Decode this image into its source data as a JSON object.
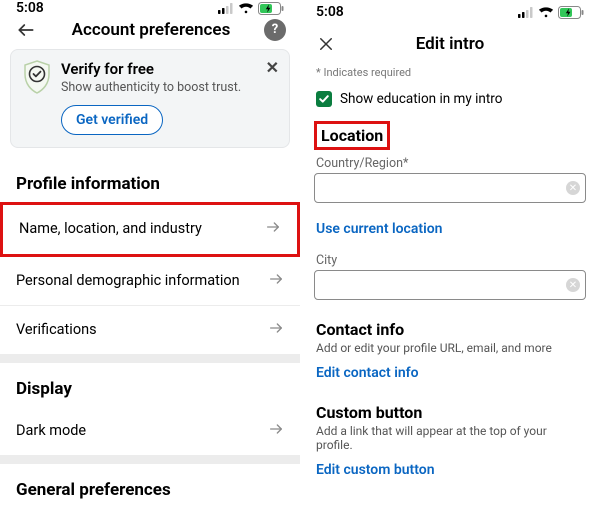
{
  "status": {
    "time": "5:08"
  },
  "left": {
    "header": {
      "title": "Account preferences"
    },
    "verify": {
      "title": "Verify for free",
      "subtitle": "Show authenticity to boost trust.",
      "button": "Get verified"
    },
    "sections": {
      "profile_h": "Profile information",
      "items": {
        "name_loc": "Name, location, and industry",
        "demographic": "Personal demographic information",
        "verifications": "Verifications"
      },
      "display_h": "Display",
      "dark_mode": "Dark mode",
      "general_h": "General preferences"
    }
  },
  "right": {
    "header": {
      "title": "Edit intro"
    },
    "required_note": "* Indicates required",
    "show_edu": "Show education in my intro",
    "location_h": "Location",
    "country_label": "Country/Region*",
    "country_value": "",
    "use_current": "Use current location",
    "city_label": "City",
    "city_value": "",
    "contact": {
      "h": "Contact info",
      "d": "Add or edit your profile URL, email, and more",
      "link": "Edit contact info"
    },
    "custom": {
      "h": "Custom button",
      "d": "Add a link that will appear at the top of your profile.",
      "link": "Edit custom button"
    }
  }
}
